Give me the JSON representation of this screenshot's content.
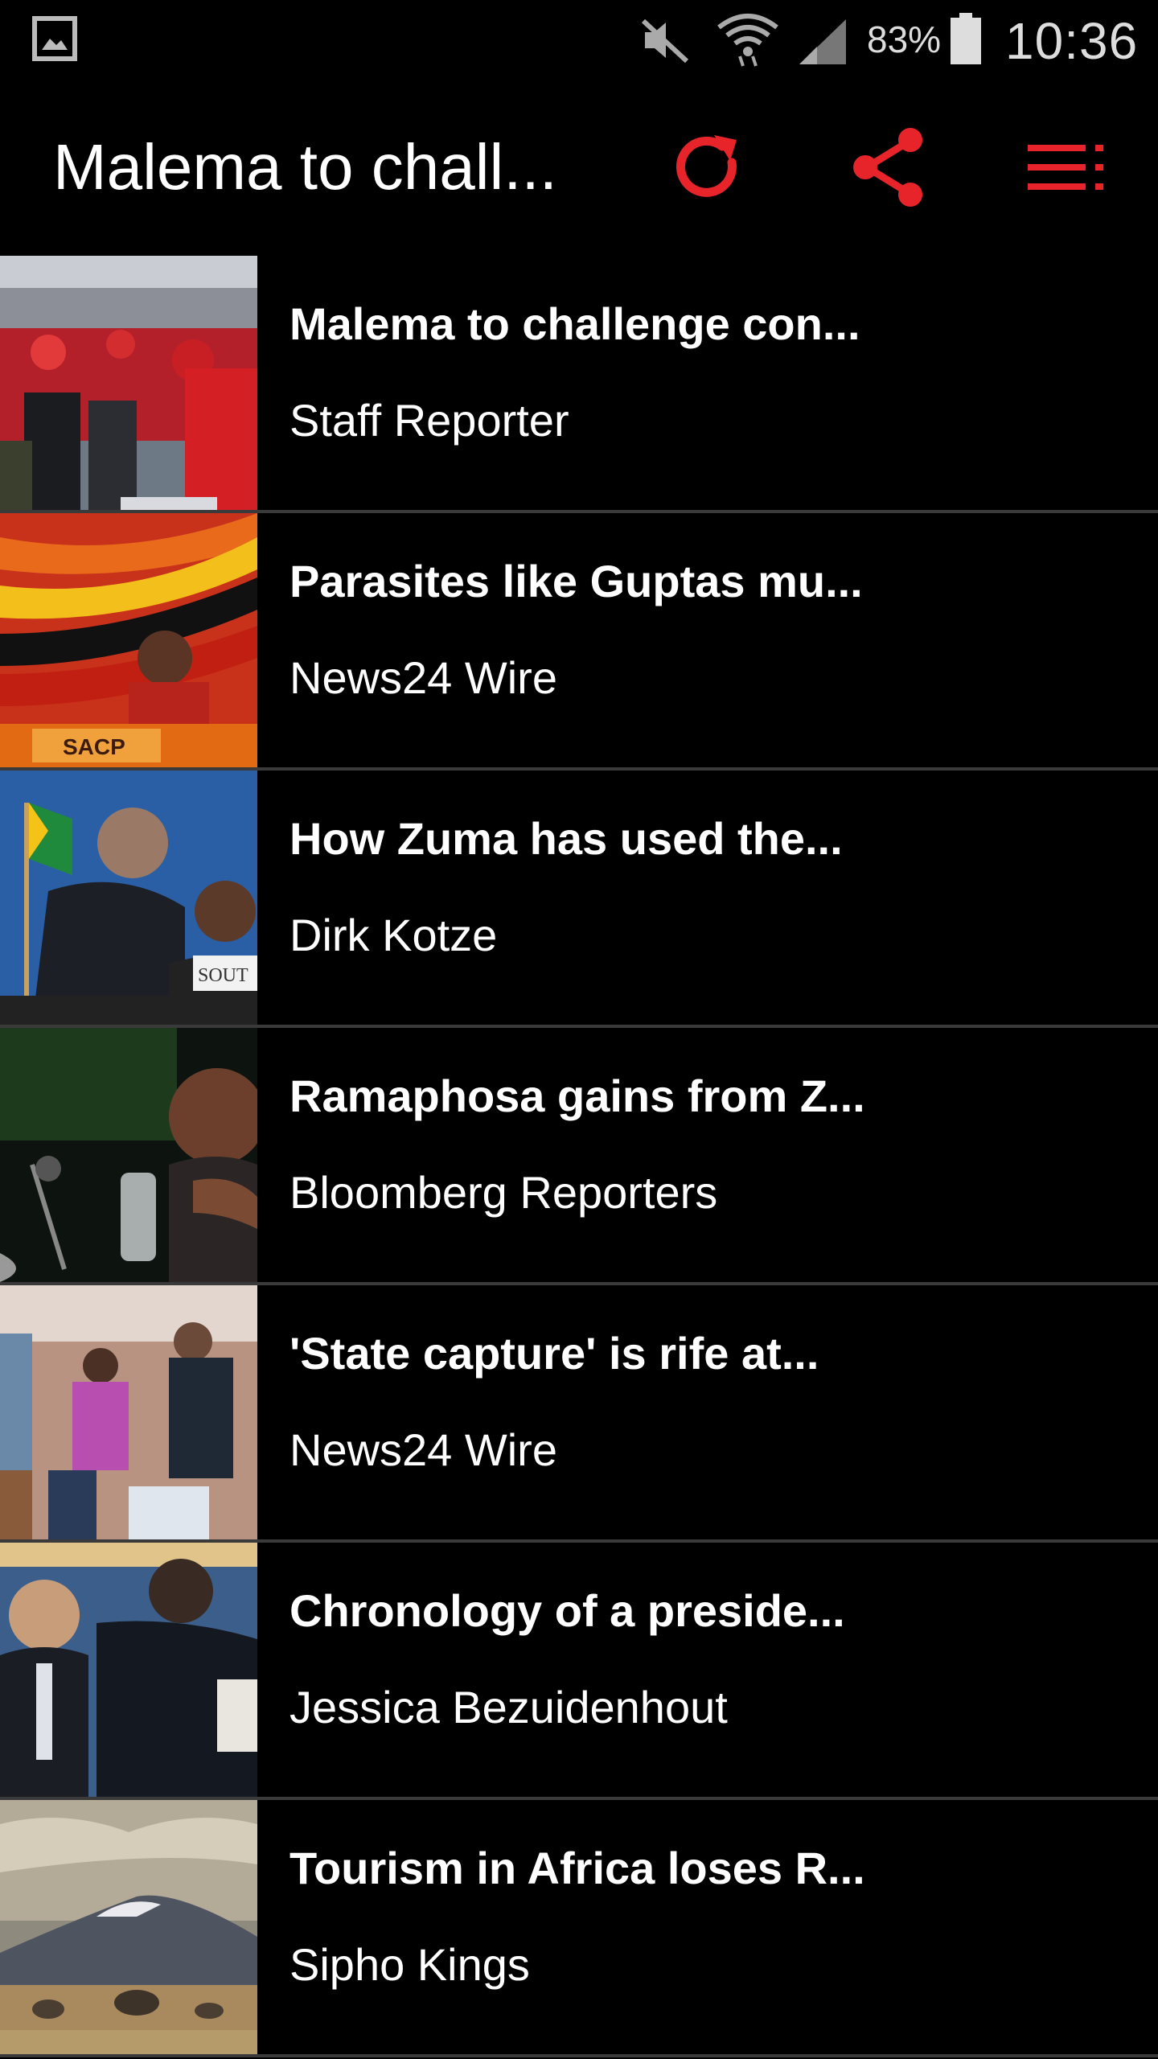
{
  "status_bar": {
    "battery_percent": "83%",
    "time": "10:36",
    "icons": [
      "gallery-icon",
      "mute-icon",
      "wifi-icon",
      "signal-icon",
      "battery-icon"
    ]
  },
  "app_bar": {
    "title": "Malema to chall...",
    "actions": [
      "refresh-icon",
      "share-icon",
      "menu-list-icon"
    ],
    "accent_color": "#e8242b"
  },
  "articles": [
    {
      "title": "Malema to challenge con...",
      "author": "Staff Reporter"
    },
    {
      "title": "Parasites like Guptas mu...",
      "author": "News24 Wire",
      "thumb_text": "SACP"
    },
    {
      "title": "How Zuma has used the...",
      "author": "Dirk Kotze",
      "thumb_text": "SOUT"
    },
    {
      "title": "Ramaphosa gains from Z...",
      "author": "Bloomberg Reporters"
    },
    {
      "title": "'State capture' is rife at...",
      "author": "News24 Wire"
    },
    {
      "title": "Chronology of a preside...",
      "author": "Jessica Bezuidenhout"
    },
    {
      "title": "Tourism in Africa loses R...",
      "author": "Sipho Kings"
    }
  ]
}
